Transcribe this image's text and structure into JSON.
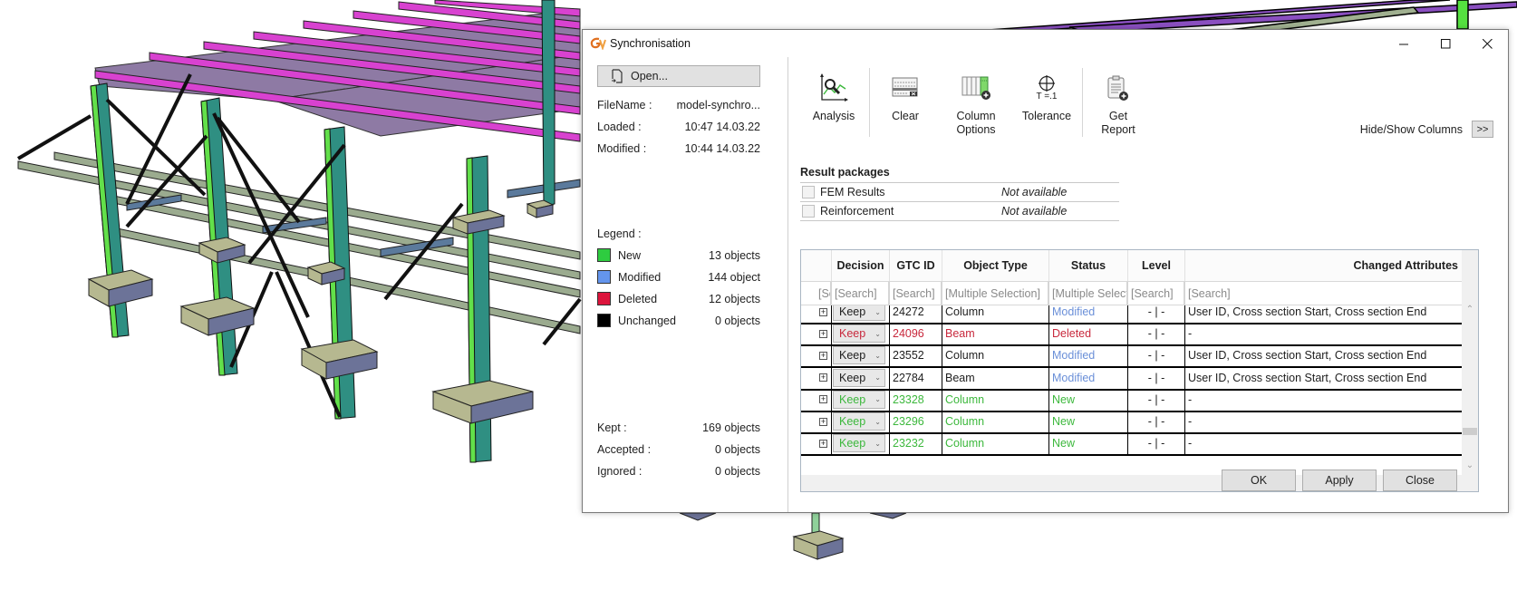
{
  "dialog": {
    "title": "Synchronisation",
    "app_icon": "app-logo-icon",
    "window_controls": [
      "minimize",
      "maximize",
      "close"
    ]
  },
  "left_panel": {
    "open_button": "Open...",
    "file_info": [
      {
        "label": "FileName :",
        "value": "model-synchro..."
      },
      {
        "label": "Loaded :",
        "value": "10:47 14.03.22"
      },
      {
        "label": "Modified :",
        "value": "10:44 14.03.22"
      }
    ],
    "legend_title": "Legend :",
    "legend": [
      {
        "label": "New",
        "count": "13 objects",
        "color": "#2ecc40"
      },
      {
        "label": "Modified",
        "count": "144 object",
        "color": "#6495ed"
      },
      {
        "label": "Deleted",
        "count": "12 objects",
        "color": "#dc143c"
      },
      {
        "label": "Unchanged",
        "count": "0 objects",
        "color": "#000000"
      }
    ],
    "summary": [
      {
        "label": "Kept :",
        "value": "169 objects"
      },
      {
        "label": "Accepted :",
        "value": "0 objects"
      },
      {
        "label": "Ignored :",
        "value": "0 objects"
      }
    ]
  },
  "toolbar": {
    "items": [
      {
        "label": "Analysis",
        "icon": "analysis-icon"
      },
      {
        "label": "Clear",
        "icon": "clear-icon"
      },
      {
        "label": "Column\nOptions",
        "icon": "column-options-icon"
      },
      {
        "label": "Tolerance",
        "icon": "tolerance-icon",
        "icon_text": "T =.1"
      },
      {
        "label": "Get\nReport",
        "icon": "get-report-icon"
      }
    ],
    "hide_show_label": "Hide/Show Columns",
    "hide_show_button": ">>"
  },
  "result_packages": {
    "title": "Result packages",
    "items": [
      {
        "name": "FEM Results",
        "availability": "Not available",
        "checked": false
      },
      {
        "name": "Reinforcement",
        "availability": "Not available",
        "checked": false
      }
    ]
  },
  "grid": {
    "columns": [
      "",
      "Decision",
      "GTC ID",
      "Object Type",
      "Status",
      "Level",
      "Changed Attributes"
    ],
    "filters": [
      "[Se",
      "[Search]",
      "[Search]",
      "[Multiple Selection]",
      "[Multiple Selecti",
      "[Search]",
      "[Search]"
    ],
    "rows": [
      {
        "decision": "Keep",
        "gtc_id": "24272",
        "object_type": "Column",
        "status": "Modified",
        "level": "- | -",
        "changed": "User ID, Cross section Start, Cross section End",
        "kind": "modified"
      },
      {
        "decision": "Keep",
        "gtc_id": "24096",
        "object_type": "Beam",
        "status": "Deleted",
        "level": "- | -",
        "changed": "-",
        "kind": "deleted"
      },
      {
        "decision": "Keep",
        "gtc_id": "23552",
        "object_type": "Column",
        "status": "Modified",
        "level": "- | -",
        "changed": "User ID, Cross section Start, Cross section End",
        "kind": "modified"
      },
      {
        "decision": "Keep",
        "gtc_id": "22784",
        "object_type": "Beam",
        "status": "Modified",
        "level": "- | -",
        "changed": "User ID, Cross section Start, Cross section End",
        "kind": "modified"
      },
      {
        "decision": "Keep",
        "gtc_id": "23328",
        "object_type": "Column",
        "status": "New",
        "level": "- | -",
        "changed": "-",
        "kind": "new"
      },
      {
        "decision": "Keep",
        "gtc_id": "23296",
        "object_type": "Column",
        "status": "New",
        "level": "- | -",
        "changed": "-",
        "kind": "new"
      },
      {
        "decision": "Keep",
        "gtc_id": "23232",
        "object_type": "Column",
        "status": "New",
        "level": "- | -",
        "changed": "-",
        "kind": "new"
      }
    ],
    "text_colors": {
      "modified_status": "#6a8fd8",
      "deleted": "#c8283c",
      "new": "#3cb83c",
      "default": "#1e1e1e"
    }
  },
  "footer": {
    "ok": "OK",
    "apply": "Apply",
    "close": "Close"
  }
}
